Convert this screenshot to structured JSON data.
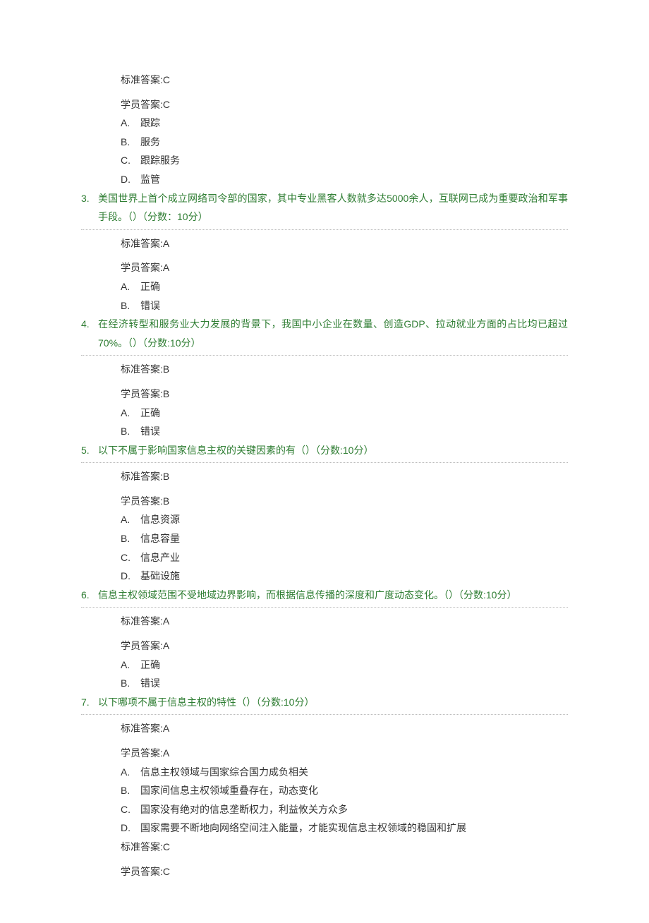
{
  "labels": {
    "standardAnswer": "标准答案:",
    "studentAnswer": "学员答案:"
  },
  "questions": [
    {
      "num": "",
      "text": "",
      "score": "",
      "standard": "C",
      "student": "C",
      "options": [
        {
          "marker": "A.",
          "text": "跟踪"
        },
        {
          "marker": "B.",
          "text": "服务"
        },
        {
          "marker": "C.",
          "text": "跟踪服务"
        },
        {
          "marker": "D.",
          "text": "监管"
        }
      ],
      "showQuestion": false,
      "showHr": false
    },
    {
      "num": "3.",
      "text": "美国世界上首个成立网络司令部的国家，其中专业黑客人数就多达5000余人，互联网已成为重要政治和军事手段。（）",
      "score": "（分数：10分）",
      "standard": "A",
      "student": "A",
      "options": [
        {
          "marker": "A.",
          "text": "正确"
        },
        {
          "marker": "B.",
          "text": "错误"
        }
      ],
      "showQuestion": true,
      "showHr": true
    },
    {
      "num": "4.",
      "text": "在经济转型和服务业大力发展的背景下，我国中小企业在数量、创造GDP、拉动就业方面的占比均已超过70%。（）",
      "score": "（分数:10分）",
      "standard": "B",
      "student": "B",
      "options": [
        {
          "marker": "A.",
          "text": "正确"
        },
        {
          "marker": "B.",
          "text": "错误"
        }
      ],
      "showQuestion": true,
      "showHr": true
    },
    {
      "num": "5.",
      "text": "以下不属于影响国家信息主权的关键因素的有（）",
      "score": "（分数:10分）",
      "standard": "B",
      "student": "B",
      "options": [
        {
          "marker": "A.",
          "text": "信息资源"
        },
        {
          "marker": "B.",
          "text": "信息容量"
        },
        {
          "marker": "C.",
          "text": "信息产业"
        },
        {
          "marker": "D.",
          "text": "基础设施"
        }
      ],
      "showQuestion": true,
      "showHr": true
    },
    {
      "num": "6.",
      "text": "信息主权领域范围不受地域边界影响，而根据信息传播的深度和广度动态变化。（）",
      "score": "（分数:10分）",
      "standard": "A",
      "student": "A",
      "options": [
        {
          "marker": "A.",
          "text": "正确"
        },
        {
          "marker": "B.",
          "text": "错误"
        }
      ],
      "showQuestion": true,
      "showHr": true
    },
    {
      "num": "7.",
      "text": "以下哪项不属于信息主权的特性（）",
      "score": "（分数:10分）",
      "standard": "A",
      "student": "A",
      "options": [
        {
          "marker": "A.",
          "text": "信息主权领域与国家综合国力成负相关"
        },
        {
          "marker": "B.",
          "text": "国家间信息主权领域重叠存在，动态变化"
        },
        {
          "marker": "C.",
          "text": "国家没有绝对的信息垄断权力，利益攸关方众多"
        },
        {
          "marker": "D.",
          "text": "国家需要不断地向网络空间注入能量，才能实现信息主权领域的稳固和扩展"
        }
      ],
      "showQuestion": true,
      "showHr": true
    },
    {
      "num": "",
      "text": "",
      "score": "",
      "standard": "C",
      "student": "C",
      "options": [],
      "showQuestion": false,
      "showHr": false,
      "trailing": true
    }
  ]
}
